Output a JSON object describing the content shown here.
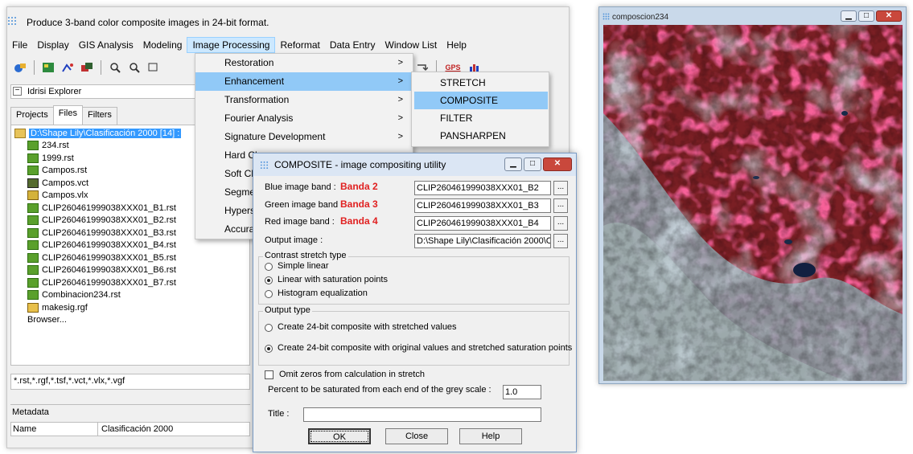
{
  "main_window": {
    "hint": "Produce 3-band color composite images in 24-bit format.",
    "menu": [
      "File",
      "Display",
      "GIS Analysis",
      "Modeling",
      "Image Processing",
      "Reformat",
      "Data Entry",
      "Window List",
      "Help"
    ],
    "toolbar_gps": "GPS"
  },
  "explorer": {
    "title": "Idrisi Explorer",
    "tabs": [
      "Projects",
      "Files",
      "Filters"
    ],
    "folder": "D:\\Shape Lily\\Clasificación 2000 [14] :",
    "files": [
      {
        "name": "234.rst",
        "type": "rst"
      },
      {
        "name": "1999.rst",
        "type": "rst"
      },
      {
        "name": "Campos.rst",
        "type": "rst"
      },
      {
        "name": "Campos.vct",
        "type": "vct"
      },
      {
        "name": "Campos.vlx",
        "type": "vlx"
      },
      {
        "name": "CLIP260461999038XXX01_B1.rst",
        "type": "rst"
      },
      {
        "name": "CLIP260461999038XXX01_B2.rst",
        "type": "rst"
      },
      {
        "name": "CLIP260461999038XXX01_B3.rst",
        "type": "rst"
      },
      {
        "name": "CLIP260461999038XXX01_B4.rst",
        "type": "rst"
      },
      {
        "name": "CLIP260461999038XXX01_B5.rst",
        "type": "rst"
      },
      {
        "name": "CLIP260461999038XXX01_B6.rst",
        "type": "rst"
      },
      {
        "name": "CLIP260461999038XXX01_B7.rst",
        "type": "rst"
      },
      {
        "name": "Combinacion234.rst",
        "type": "rst"
      },
      {
        "name": "makesig.rgf",
        "type": "rgf"
      }
    ],
    "browser": "Browser...",
    "filter": "*.rst,*.rgf,*.tsf,*.vct,*.vlx,*.vgf",
    "metadata_title": "Metadata",
    "meta_key": "Name",
    "meta_value": "Clasificación 2000"
  },
  "image_processing_menu": {
    "items": [
      "Restoration",
      "Enhancement",
      "Transformation",
      "Fourier Analysis",
      "Signature Development",
      "Hard Classifiers",
      "Soft Classifiers",
      "Segmentation",
      "Hyperspectral",
      "Accuracy Assessment"
    ],
    "visible_items": [
      "Restoration",
      "Enhancement",
      "Transformation",
      "Fourier Analysis",
      "Signature Development",
      "Hard Cl",
      "Soft Cl",
      "Segme",
      "Hypers",
      "Accura"
    ]
  },
  "enhancement_submenu": {
    "items": [
      "STRETCH",
      "COMPOSITE",
      "FILTER",
      "PANSHARPEN"
    ]
  },
  "dialog": {
    "title": "COMPOSITE - image compositing utility",
    "blue_label": "Blue image band :",
    "green_label": "Green image band :",
    "red_label": "Red image band :",
    "blue_band": "Banda 2",
    "green_band": "Banda 3",
    "red_band": "Banda 4",
    "blue_value": "CLIP260461999038XXX01_B2",
    "green_value": "CLIP260461999038XXX01_B3",
    "red_value": "CLIP260461999038XXX01_B4",
    "output_label": "Output image :",
    "output_value": "D:\\Shape Lily\\Clasificación 2000\\Co",
    "browse": "...",
    "contrast_title": "Contrast stretch type",
    "contrast_options": [
      "Simple linear",
      "Linear with saturation points",
      "Histogram equalization"
    ],
    "output_type_title": "Output type",
    "output_options": [
      "Create 24-bit composite with stretched values",
      "Create 24-bit composite with original values and stretched saturation points"
    ],
    "omit_zeros": "Omit zeros from calculation in stretch",
    "percent_label": "Percent to be saturated from each end of the grey scale :",
    "percent_value": "1.0",
    "title_label": "Title :",
    "title_value": "",
    "ok": "OK",
    "close": "Close",
    "help": "Help"
  },
  "image_window": {
    "title": "composcion234"
  }
}
